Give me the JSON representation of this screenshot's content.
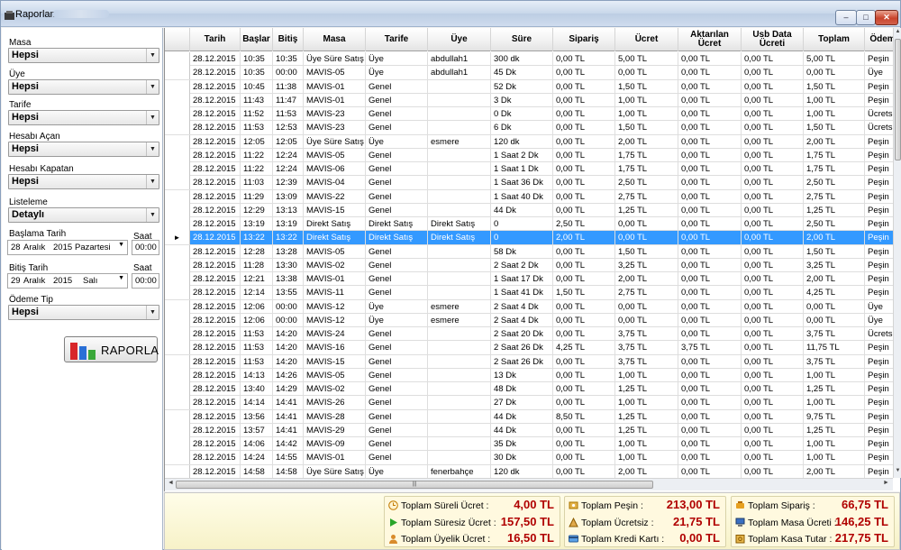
{
  "window": {
    "title": "Raporlama",
    "btn_min": "–",
    "btn_max": "□",
    "btn_close": "✕"
  },
  "filters": {
    "masa": {
      "label": "Masa",
      "value": "Hepsi"
    },
    "uye": {
      "label": "Üye",
      "value": "Hepsi"
    },
    "tarife": {
      "label": "Tarife",
      "value": "Hepsi"
    },
    "hesabi_acan": {
      "label": "Hesabı Açan",
      "value": "Hepsi"
    },
    "hesabi_kapatan": {
      "label": "Hesabı Kapatan",
      "value": "Hepsi"
    },
    "listeleme": {
      "label": "Listeleme",
      "value": "Detaylı"
    },
    "baslama": {
      "label": "Başlama Tarih",
      "day": "28",
      "month": "Aralık",
      "year": "2015",
      "weekday": "Pazartesi",
      "saat_label": "Saat",
      "saat": "00:00"
    },
    "bitis": {
      "label": "Bitiş Tarih",
      "day": "29",
      "month": "Aralık",
      "year": "2015",
      "weekday": "Salı",
      "saat_label": "Saat",
      "saat": "00:00"
    },
    "odeme_tip": {
      "label": "Ödeme Tip",
      "value": "Hepsi"
    },
    "raporla_label": "RAPORLA"
  },
  "columns": [
    "Tarih",
    "Başlar",
    "Bitiş",
    "Masa",
    "Tarife",
    "Üye",
    "Süre",
    "Sipariş",
    "Ücret",
    "Aktarılan\nÜcret",
    "Usb Data\nÜcreti",
    "Toplam",
    "Ödem"
  ],
  "rows": [
    [
      "28.12.2015",
      "10:35",
      "10:35",
      "Üye Süre Satış",
      "Üye",
      "abdullah1",
      "300 dk",
      "0,00 TL",
      "5,00 TL",
      "0,00 TL",
      "0,00 TL",
      "5,00 TL",
      "Peşin"
    ],
    [
      "28.12.2015",
      "10:35",
      "00:00",
      "MAVIS-05",
      "Üye",
      "abdullah1",
      "45 Dk",
      "0,00 TL",
      "0,00 TL",
      "0,00 TL",
      "0,00 TL",
      "0,00 TL",
      "Üye"
    ],
    [
      "28.12.2015",
      "10:45",
      "11:38",
      "MAVIS-01",
      "Genel",
      "",
      "52 Dk",
      "0,00 TL",
      "1,50 TL",
      "0,00 TL",
      "0,00 TL",
      "1,50 TL",
      "Peşin"
    ],
    [
      "28.12.2015",
      "11:43",
      "11:47",
      "MAVIS-01",
      "Genel",
      "",
      "3 Dk",
      "0,00 TL",
      "1,00 TL",
      "0,00 TL",
      "0,00 TL",
      "1,00 TL",
      "Peşin"
    ],
    [
      "28.12.2015",
      "11:52",
      "11:53",
      "MAVIS-23",
      "Genel",
      "",
      "0 Dk",
      "0,00 TL",
      "1,00 TL",
      "0,00 TL",
      "0,00 TL",
      "1,00 TL",
      "Ücretsi"
    ],
    [
      "28.12.2015",
      "11:53",
      "12:53",
      "MAVIS-23",
      "Genel",
      "",
      "6 Dk",
      "0,00 TL",
      "1,50 TL",
      "0,00 TL",
      "0,00 TL",
      "1,50 TL",
      "Ücretsi"
    ],
    [
      "28.12.2015",
      "12:05",
      "12:05",
      "Üye Süre Satış",
      "Üye",
      "esmere",
      "120 dk",
      "0,00 TL",
      "2,00 TL",
      "0,00 TL",
      "0,00 TL",
      "2,00 TL",
      "Peşin"
    ],
    [
      "28.12.2015",
      "11:22",
      "12:24",
      "MAVIS-05",
      "Genel",
      "",
      "1 Saat 2 Dk",
      "0,00 TL",
      "1,75 TL",
      "0,00 TL",
      "0,00 TL",
      "1,75 TL",
      "Peşin"
    ],
    [
      "28.12.2015",
      "11:22",
      "12:24",
      "MAVIS-06",
      "Genel",
      "",
      "1 Saat 1 Dk",
      "0,00 TL",
      "1,75 TL",
      "0,00 TL",
      "0,00 TL",
      "1,75 TL",
      "Peşin"
    ],
    [
      "28.12.2015",
      "11:03",
      "12:39",
      "MAVIS-04",
      "Genel",
      "",
      "1 Saat 36 Dk",
      "0,00 TL",
      "2,50 TL",
      "0,00 TL",
      "0,00 TL",
      "2,50 TL",
      "Peşin"
    ],
    [
      "28.12.2015",
      "11:29",
      "13:09",
      "MAVIS-22",
      "Genel",
      "",
      "1 Saat 40 Dk",
      "0,00 TL",
      "2,75 TL",
      "0,00 TL",
      "0,00 TL",
      "2,75 TL",
      "Peşin"
    ],
    [
      "28.12.2015",
      "12:29",
      "13:13",
      "MAVIS-15",
      "Genel",
      "",
      "44 Dk",
      "0,00 TL",
      "1,25 TL",
      "0,00 TL",
      "0,00 TL",
      "1,25 TL",
      "Peşin"
    ],
    [
      "28.12.2015",
      "13:19",
      "13:19",
      "Direkt Satış",
      "Direkt Satış",
      "Direkt Satış",
      "0",
      "2,50 TL",
      "0,00 TL",
      "0,00 TL",
      "0,00 TL",
      "2,50 TL",
      "Peşin"
    ],
    [
      "28.12.2015",
      "13:22",
      "13:22",
      "Direkt Satış",
      "Direkt Satış",
      "Direkt Satış",
      "0",
      "2,00 TL",
      "0,00 TL",
      "0,00 TL",
      "0,00 TL",
      "2,00 TL",
      "Peşin"
    ],
    [
      "28.12.2015",
      "12:28",
      "13:28",
      "MAVIS-05",
      "Genel",
      "",
      "58 Dk",
      "0,00 TL",
      "1,50 TL",
      "0,00 TL",
      "0,00 TL",
      "1,50 TL",
      "Peşin"
    ],
    [
      "28.12.2015",
      "11:28",
      "13:30",
      "MAVIS-02",
      "Genel",
      "",
      "2 Saat 2 Dk",
      "0,00 TL",
      "3,25 TL",
      "0,00 TL",
      "0,00 TL",
      "3,25 TL",
      "Peşin"
    ],
    [
      "28.12.2015",
      "12:21",
      "13:38",
      "MAVIS-01",
      "Genel",
      "",
      "1 Saat 17 Dk",
      "0,00 TL",
      "2,00 TL",
      "0,00 TL",
      "0,00 TL",
      "2,00 TL",
      "Peşin"
    ],
    [
      "28.12.2015",
      "12:14",
      "13:55",
      "MAVIS-11",
      "Genel",
      "",
      "1 Saat 41 Dk",
      "1,50 TL",
      "2,75 TL",
      "0,00 TL",
      "0,00 TL",
      "4,25 TL",
      "Peşin"
    ],
    [
      "28.12.2015",
      "12:06",
      "00:00",
      "MAVIS-12",
      "Üye",
      "esmere",
      "2 Saat 4 Dk",
      "0,00 TL",
      "0,00 TL",
      "0,00 TL",
      "0,00 TL",
      "0,00 TL",
      "Üye"
    ],
    [
      "28.12.2015",
      "12:06",
      "00:00",
      "MAVIS-12",
      "Üye",
      "esmere",
      "2 Saat 4 Dk",
      "0,00 TL",
      "0,00 TL",
      "0,00 TL",
      "0,00 TL",
      "0,00 TL",
      "Üye"
    ],
    [
      "28.12.2015",
      "11:53",
      "14:20",
      "MAVIS-24",
      "Genel",
      "",
      "2 Saat 20 Dk",
      "0,00 TL",
      "3,75 TL",
      "0,00 TL",
      "0,00 TL",
      "3,75 TL",
      "Ücretsi"
    ],
    [
      "28.12.2015",
      "11:53",
      "14:20",
      "MAVIS-16",
      "Genel",
      "",
      "2 Saat 26 Dk",
      "4,25 TL",
      "3,75 TL",
      "3,75 TL",
      "0,00 TL",
      "11,75 TL",
      "Peşin"
    ],
    [
      "28.12.2015",
      "11:53",
      "14:20",
      "MAVIS-15",
      "Genel",
      "",
      "2 Saat 26 Dk",
      "0,00 TL",
      "3,75 TL",
      "0,00 TL",
      "0,00 TL",
      "3,75 TL",
      "Peşin"
    ],
    [
      "28.12.2015",
      "14:13",
      "14:26",
      "MAVIS-05",
      "Genel",
      "",
      "13 Dk",
      "0,00 TL",
      "1,00 TL",
      "0,00 TL",
      "0,00 TL",
      "1,00 TL",
      "Peşin"
    ],
    [
      "28.12.2015",
      "13:40",
      "14:29",
      "MAVIS-02",
      "Genel",
      "",
      "48 Dk",
      "0,00 TL",
      "1,25 TL",
      "0,00 TL",
      "0,00 TL",
      "1,25 TL",
      "Peşin"
    ],
    [
      "28.12.2015",
      "14:14",
      "14:41",
      "MAVIS-26",
      "Genel",
      "",
      "27 Dk",
      "0,00 TL",
      "1,00 TL",
      "0,00 TL",
      "0,00 TL",
      "1,00 TL",
      "Peşin"
    ],
    [
      "28.12.2015",
      "13:56",
      "14:41",
      "MAVIS-28",
      "Genel",
      "",
      "44 Dk",
      "8,50 TL",
      "1,25 TL",
      "0,00 TL",
      "0,00 TL",
      "9,75 TL",
      "Peşin"
    ],
    [
      "28.12.2015",
      "13:57",
      "14:41",
      "MAVIS-29",
      "Genel",
      "",
      "44 Dk",
      "0,00 TL",
      "1,25 TL",
      "0,00 TL",
      "0,00 TL",
      "1,25 TL",
      "Peşin"
    ],
    [
      "28.12.2015",
      "14:06",
      "14:42",
      "MAVIS-09",
      "Genel",
      "",
      "35 Dk",
      "0,00 TL",
      "1,00 TL",
      "0,00 TL",
      "0,00 TL",
      "1,00 TL",
      "Peşin"
    ],
    [
      "28.12.2015",
      "14:24",
      "14:55",
      "MAVIS-01",
      "Genel",
      "",
      "30 Dk",
      "0,00 TL",
      "1,00 TL",
      "0,00 TL",
      "0,00 TL",
      "1,00 TL",
      "Peşin"
    ],
    [
      "28.12.2015",
      "14:58",
      "14:58",
      "Üye Süre Satış",
      "Üye",
      "fenerbahçe",
      "120 dk",
      "0,00 TL",
      "2,00 TL",
      "0,00 TL",
      "0,00 TL",
      "2,00 TL",
      "Peşin"
    ]
  ],
  "selected_row": 13,
  "summary": {
    "col1": [
      {
        "icon": "clock-icon",
        "label": "Toplam Süreli Ücret :",
        "value": "4,00 TL"
      },
      {
        "icon": "play-icon",
        "label": "Toplam Süresiz Ücret :",
        "value": "157,50 TL"
      },
      {
        "icon": "user-icon",
        "label": "Toplam Üyelik Ücret :",
        "value": "16,50 TL"
      }
    ],
    "col2": [
      {
        "icon": "cash-icon",
        "label": "Toplam Peşin :",
        "value": "213,00 TL"
      },
      {
        "icon": "free-icon",
        "label": "Toplam Ücretsiz :",
        "value": "21,75 TL"
      },
      {
        "icon": "credit-card-icon",
        "label": "Toplam Kredi Kartı :",
        "value": "0,00 TL"
      }
    ],
    "col3": [
      {
        "icon": "order-icon",
        "label": "Toplam Sipariş :",
        "value": "66,75 TL"
      },
      {
        "icon": "computer-icon",
        "label": "Toplam Masa Ücreti :",
        "value": "146,25 TL"
      },
      {
        "icon": "safe-icon",
        "label": "Toplam Kasa Tutar :",
        "value": "217,75 TL"
      }
    ]
  },
  "colors": {
    "selection": "#3399ff",
    "summary_value": "#b00000"
  }
}
